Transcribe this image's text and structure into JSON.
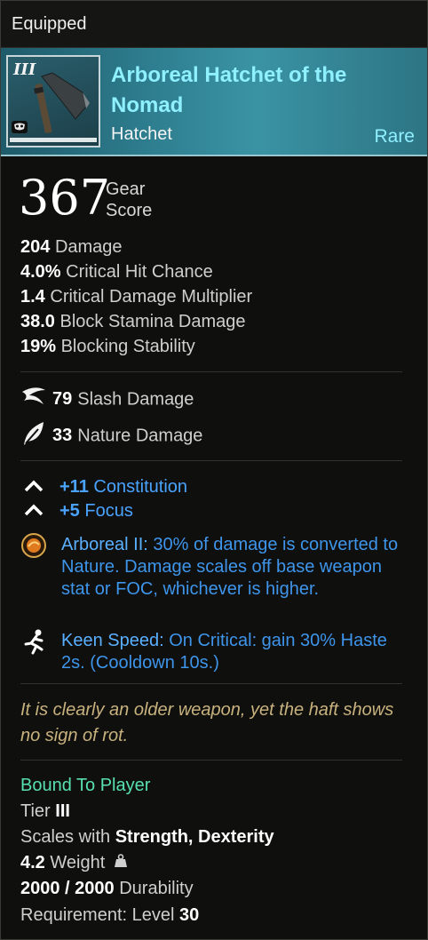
{
  "topbar": {
    "title": "Equipped"
  },
  "item": {
    "tier_numeral": "III",
    "name": "Arboreal Hatchet of the Nomad",
    "type": "Hatchet",
    "rarity": "Rare"
  },
  "gear_score": {
    "value": "367",
    "label": "Gear Score"
  },
  "stats": [
    {
      "value": "204",
      "label": "Damage"
    },
    {
      "value": "4.0%",
      "label": "Critical Hit Chance"
    },
    {
      "value": "1.4",
      "label": "Critical Damage Multiplier"
    },
    {
      "value": "38.0",
      "label": "Block Stamina Damage"
    },
    {
      "value": "19%",
      "label": "Blocking Stability"
    }
  ],
  "damage_types": [
    {
      "icon": "slash-icon",
      "value": "79",
      "label": "Slash Damage"
    },
    {
      "icon": "leaf-icon",
      "value": "33",
      "label": "Nature Damage"
    }
  ],
  "attributes": [
    {
      "value": "+11",
      "label": "Constitution"
    },
    {
      "value": "+5",
      "label": "Focus"
    }
  ],
  "perks": [
    {
      "icon": "arboreal-perk-icon",
      "name": "Arboreal II:",
      "desc": "30% of damage is converted to Nature. Damage scales off base weapon stat or FOC, whichever is higher."
    },
    {
      "icon": "runner-icon",
      "name": "Keen Speed:",
      "desc": "On Critical: gain 30% Haste 2s. (Cooldown 10s.)"
    }
  ],
  "lore": "It is clearly an older weapon, yet the haft shows no sign of rot.",
  "footer": {
    "bind": "Bound To Player",
    "tier_label": "Tier",
    "tier_value": "III",
    "scales_label": "Scales with",
    "scales_value": "Strength, Dexterity",
    "weight_value": "4.2",
    "weight_label": "Weight",
    "durability_value": "2000 / 2000",
    "durability_label": "Durability",
    "requirement_label": "Requirement: Level",
    "requirement_value": "30"
  },
  "colors": {
    "rarity": "#8ff0ff",
    "perk_text": "#3e95ea",
    "lore": "#c8b27e",
    "bind": "#58e0b0"
  }
}
